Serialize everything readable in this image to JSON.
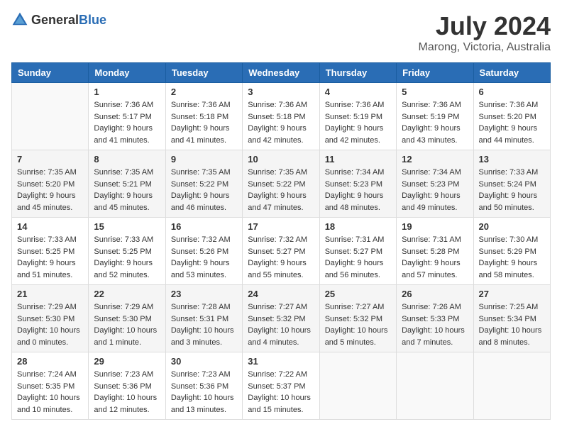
{
  "header": {
    "logo_general": "General",
    "logo_blue": "Blue",
    "month_year": "July 2024",
    "location": "Marong, Victoria, Australia"
  },
  "weekdays": [
    "Sunday",
    "Monday",
    "Tuesday",
    "Wednesday",
    "Thursday",
    "Friday",
    "Saturday"
  ],
  "weeks": [
    [
      {
        "day": "",
        "info": ""
      },
      {
        "day": "1",
        "info": "Sunrise: 7:36 AM\nSunset: 5:17 PM\nDaylight: 9 hours\nand 41 minutes."
      },
      {
        "day": "2",
        "info": "Sunrise: 7:36 AM\nSunset: 5:18 PM\nDaylight: 9 hours\nand 41 minutes."
      },
      {
        "day": "3",
        "info": "Sunrise: 7:36 AM\nSunset: 5:18 PM\nDaylight: 9 hours\nand 42 minutes."
      },
      {
        "day": "4",
        "info": "Sunrise: 7:36 AM\nSunset: 5:19 PM\nDaylight: 9 hours\nand 42 minutes."
      },
      {
        "day": "5",
        "info": "Sunrise: 7:36 AM\nSunset: 5:19 PM\nDaylight: 9 hours\nand 43 minutes."
      },
      {
        "day": "6",
        "info": "Sunrise: 7:36 AM\nSunset: 5:20 PM\nDaylight: 9 hours\nand 44 minutes."
      }
    ],
    [
      {
        "day": "7",
        "info": "Sunrise: 7:35 AM\nSunset: 5:20 PM\nDaylight: 9 hours\nand 45 minutes."
      },
      {
        "day": "8",
        "info": "Sunrise: 7:35 AM\nSunset: 5:21 PM\nDaylight: 9 hours\nand 45 minutes."
      },
      {
        "day": "9",
        "info": "Sunrise: 7:35 AM\nSunset: 5:22 PM\nDaylight: 9 hours\nand 46 minutes."
      },
      {
        "day": "10",
        "info": "Sunrise: 7:35 AM\nSunset: 5:22 PM\nDaylight: 9 hours\nand 47 minutes."
      },
      {
        "day": "11",
        "info": "Sunrise: 7:34 AM\nSunset: 5:23 PM\nDaylight: 9 hours\nand 48 minutes."
      },
      {
        "day": "12",
        "info": "Sunrise: 7:34 AM\nSunset: 5:23 PM\nDaylight: 9 hours\nand 49 minutes."
      },
      {
        "day": "13",
        "info": "Sunrise: 7:33 AM\nSunset: 5:24 PM\nDaylight: 9 hours\nand 50 minutes."
      }
    ],
    [
      {
        "day": "14",
        "info": "Sunrise: 7:33 AM\nSunset: 5:25 PM\nDaylight: 9 hours\nand 51 minutes."
      },
      {
        "day": "15",
        "info": "Sunrise: 7:33 AM\nSunset: 5:25 PM\nDaylight: 9 hours\nand 52 minutes."
      },
      {
        "day": "16",
        "info": "Sunrise: 7:32 AM\nSunset: 5:26 PM\nDaylight: 9 hours\nand 53 minutes."
      },
      {
        "day": "17",
        "info": "Sunrise: 7:32 AM\nSunset: 5:27 PM\nDaylight: 9 hours\nand 55 minutes."
      },
      {
        "day": "18",
        "info": "Sunrise: 7:31 AM\nSunset: 5:27 PM\nDaylight: 9 hours\nand 56 minutes."
      },
      {
        "day": "19",
        "info": "Sunrise: 7:31 AM\nSunset: 5:28 PM\nDaylight: 9 hours\nand 57 minutes."
      },
      {
        "day": "20",
        "info": "Sunrise: 7:30 AM\nSunset: 5:29 PM\nDaylight: 9 hours\nand 58 minutes."
      }
    ],
    [
      {
        "day": "21",
        "info": "Sunrise: 7:29 AM\nSunset: 5:30 PM\nDaylight: 10 hours\nand 0 minutes."
      },
      {
        "day": "22",
        "info": "Sunrise: 7:29 AM\nSunset: 5:30 PM\nDaylight: 10 hours\nand 1 minute."
      },
      {
        "day": "23",
        "info": "Sunrise: 7:28 AM\nSunset: 5:31 PM\nDaylight: 10 hours\nand 3 minutes."
      },
      {
        "day": "24",
        "info": "Sunrise: 7:27 AM\nSunset: 5:32 PM\nDaylight: 10 hours\nand 4 minutes."
      },
      {
        "day": "25",
        "info": "Sunrise: 7:27 AM\nSunset: 5:32 PM\nDaylight: 10 hours\nand 5 minutes."
      },
      {
        "day": "26",
        "info": "Sunrise: 7:26 AM\nSunset: 5:33 PM\nDaylight: 10 hours\nand 7 minutes."
      },
      {
        "day": "27",
        "info": "Sunrise: 7:25 AM\nSunset: 5:34 PM\nDaylight: 10 hours\nand 8 minutes."
      }
    ],
    [
      {
        "day": "28",
        "info": "Sunrise: 7:24 AM\nSunset: 5:35 PM\nDaylight: 10 hours\nand 10 minutes."
      },
      {
        "day": "29",
        "info": "Sunrise: 7:23 AM\nSunset: 5:36 PM\nDaylight: 10 hours\nand 12 minutes."
      },
      {
        "day": "30",
        "info": "Sunrise: 7:23 AM\nSunset: 5:36 PM\nDaylight: 10 hours\nand 13 minutes."
      },
      {
        "day": "31",
        "info": "Sunrise: 7:22 AM\nSunset: 5:37 PM\nDaylight: 10 hours\nand 15 minutes."
      },
      {
        "day": "",
        "info": ""
      },
      {
        "day": "",
        "info": ""
      },
      {
        "day": "",
        "info": ""
      }
    ]
  ]
}
